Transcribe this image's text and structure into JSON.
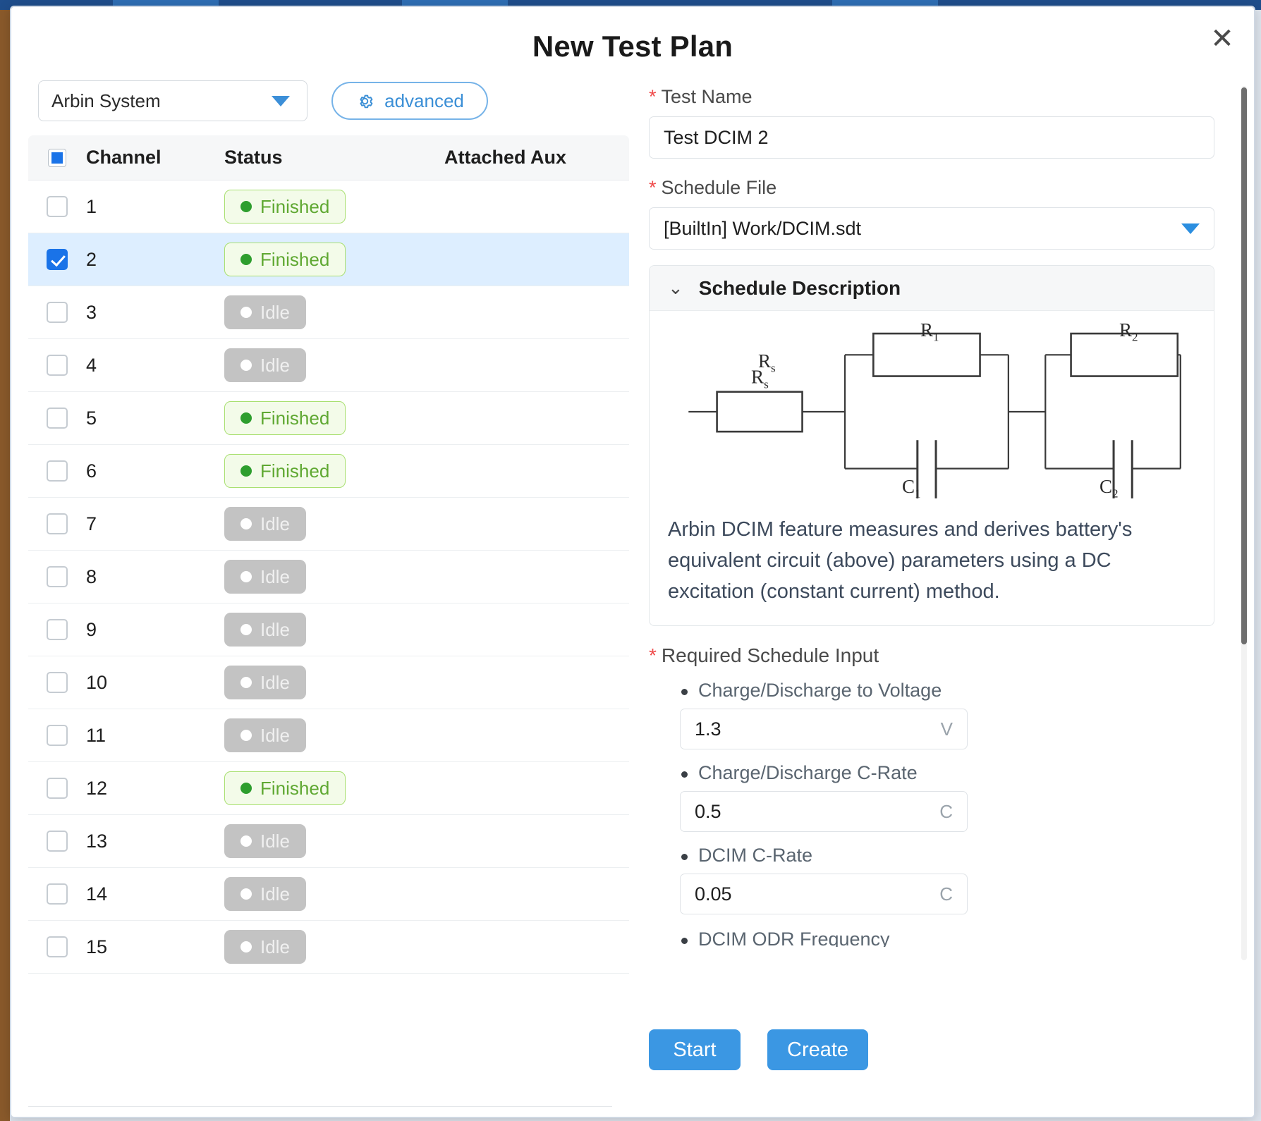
{
  "modal": {
    "title": "New Test Plan",
    "close_icon": "close-icon"
  },
  "left": {
    "system_select": {
      "value": "Arbin System",
      "caret_icon": "chevron-down-icon"
    },
    "advanced_button": {
      "label": "advanced",
      "icon": "gear-icon"
    },
    "table": {
      "headers": {
        "select_all": "select-all-checkbox",
        "channel": "Channel",
        "status": "Status",
        "attached_aux": "Attached Aux"
      },
      "rows": [
        {
          "channel": "1",
          "status": "Finished",
          "state": "finished",
          "checked": false,
          "aux": ""
        },
        {
          "channel": "2",
          "status": "Finished",
          "state": "finished",
          "checked": true,
          "aux": ""
        },
        {
          "channel": "3",
          "status": "Idle",
          "state": "idle",
          "checked": false,
          "aux": ""
        },
        {
          "channel": "4",
          "status": "Idle",
          "state": "idle",
          "checked": false,
          "aux": ""
        },
        {
          "channel": "5",
          "status": "Finished",
          "state": "finished",
          "checked": false,
          "aux": ""
        },
        {
          "channel": "6",
          "status": "Finished",
          "state": "finished",
          "checked": false,
          "aux": ""
        },
        {
          "channel": "7",
          "status": "Idle",
          "state": "idle",
          "checked": false,
          "aux": ""
        },
        {
          "channel": "8",
          "status": "Idle",
          "state": "idle",
          "checked": false,
          "aux": ""
        },
        {
          "channel": "9",
          "status": "Idle",
          "state": "idle",
          "checked": false,
          "aux": ""
        },
        {
          "channel": "10",
          "status": "Idle",
          "state": "idle",
          "checked": false,
          "aux": ""
        },
        {
          "channel": "11",
          "status": "Idle",
          "state": "idle",
          "checked": false,
          "aux": ""
        },
        {
          "channel": "12",
          "status": "Finished",
          "state": "finished",
          "checked": false,
          "aux": ""
        },
        {
          "channel": "13",
          "status": "Idle",
          "state": "idle",
          "checked": false,
          "aux": ""
        },
        {
          "channel": "14",
          "status": "Idle",
          "state": "idle",
          "checked": false,
          "aux": ""
        },
        {
          "channel": "15",
          "status": "Idle",
          "state": "idle",
          "checked": false,
          "aux": ""
        }
      ]
    }
  },
  "right": {
    "test_name": {
      "label": "Test Name",
      "required_mark": "*",
      "value": "Test DCIM 2"
    },
    "schedule_file": {
      "label": "Schedule File",
      "required_mark": "*",
      "value": "[BuiltIn] Work/DCIM.sdt",
      "caret_icon": "chevron-down-icon"
    },
    "schedule_description": {
      "header": "Schedule Description",
      "chevron_icon": "chevron-down-icon",
      "circuit_labels": {
        "rs": "R",
        "rs_sub": "s",
        "r1": "R",
        "r1_sub": "1",
        "r2": "R",
        "r2_sub": "2",
        "c1": "C",
        "c1_sub": "1",
        "c2": "C",
        "c2_sub": "2"
      },
      "text": "Arbin DCIM feature measures and derives battery's equivalent circuit (above) parameters using a DC excitation (constant current) method."
    },
    "required_schedule_input": {
      "label": "Required Schedule Input",
      "required_mark": "*",
      "items": [
        {
          "name": "Charge/Discharge to Voltage",
          "value": "1.3",
          "unit": "V"
        },
        {
          "name": "Charge/Discharge C-Rate",
          "value": "0.5",
          "unit": "C"
        },
        {
          "name": "DCIM C-Rate",
          "value": "0.05",
          "unit": "C"
        }
      ],
      "clipped_item": "DCIM ODR Frequency"
    },
    "buttons": {
      "start": "Start",
      "create": "Create"
    }
  },
  "colors": {
    "accent_blue": "#3b97e3",
    "checkbox_blue": "#1a73e8",
    "row_selected": "#ddeeff",
    "finished_text": "#5fa832",
    "finished_bg": "#f3fbe9",
    "finished_border": "#a9e071",
    "idle_bg": "#c3c3c3",
    "required_red": "#ef4b4b"
  }
}
